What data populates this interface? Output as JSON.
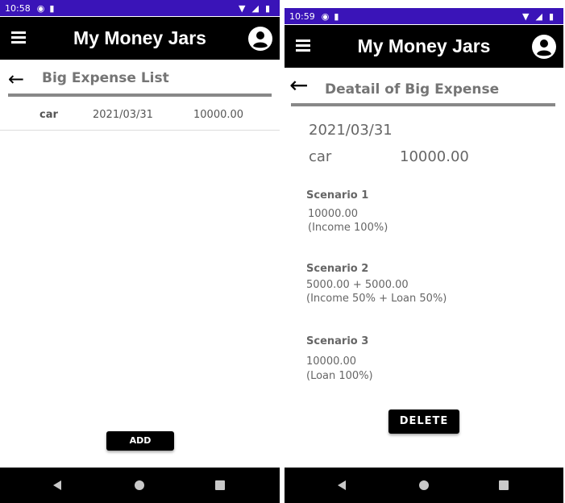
{
  "left": {
    "status": {
      "time": "10:58"
    },
    "app_bar": {
      "title": "My Money Jars"
    },
    "page": {
      "title": "Big Expense List"
    },
    "list": [
      {
        "name": "car",
        "date": "2021/03/31",
        "amount": "10000.00"
      }
    ],
    "add_label": "ADD"
  },
  "right": {
    "status": {
      "time": "10:59"
    },
    "app_bar": {
      "title": "My Money Jars"
    },
    "page": {
      "title": "Deatail of Big Expense"
    },
    "detail": {
      "date": "2021/03/31",
      "name": "car",
      "amount": "10000.00"
    },
    "scenarios": [
      {
        "title": "Scenario 1",
        "line1": "10000.00",
        "line2": "(Income 100%)"
      },
      {
        "title": "Scenario 2",
        "line1": "5000.00 + 5000.00",
        "line2": "(Income 50% + Loan 50%)"
      },
      {
        "title": "Scenario 3",
        "line1": "10000.00",
        "line2": "(Loan 100%)"
      }
    ],
    "delete_label": "DELETE"
  },
  "colors": {
    "status_bar": "#3a14b8",
    "app_bar": "#000000",
    "header_rule": "#888888",
    "secondary_text": "#666666"
  },
  "icons": {
    "menu": "hamburger-menu-icon",
    "account": "account-circle-icon",
    "back": "arrow-left-icon",
    "nav_back": "triangle-back-icon",
    "nav_home": "circle-home-icon",
    "nav_recent": "square-recents-icon"
  }
}
